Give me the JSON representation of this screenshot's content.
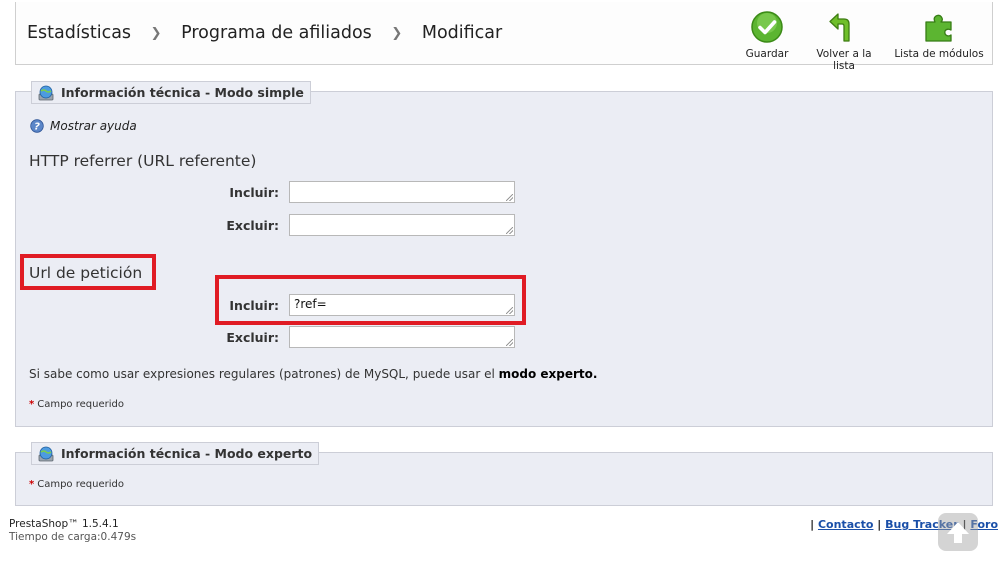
{
  "breadcrumb": {
    "items": [
      "Estadísticas",
      "Programa de afiliados",
      "Modificar"
    ],
    "separator": ">"
  },
  "toolbar": {
    "save_label": "Guardar",
    "back_label": "Volver a la lista",
    "modules_label": "Lista de módulos"
  },
  "fieldset_simple": {
    "legend": "Información técnica - Modo simple",
    "help_link": "Mostrar ayuda",
    "http_referrer": {
      "title": "HTTP referrer (URL referente)",
      "include_label": "Incluir:",
      "include_value": "",
      "exclude_label": "Excluir:",
      "exclude_value": ""
    },
    "request_url": {
      "title": "Url de petición",
      "include_label": "Incluir:",
      "include_value": "?ref=",
      "exclude_label": "Excluir:",
      "exclude_value": ""
    },
    "note_text": "Si sabe como usar expresiones regulares (patrones) de MySQL, puede usar el ",
    "note_link": "modo experto.",
    "required_star": "*",
    "required_text": "Campo requerido"
  },
  "fieldset_expert": {
    "legend": "Información técnica - Modo experto",
    "required_star": "*",
    "required_text": "Campo requerido"
  },
  "footer": {
    "version": "PrestaShop™ 1.5.4.1",
    "load_time": "Tiempo de carga:0.479s",
    "sep": "|",
    "links": [
      "Contacto",
      "Bug Tracker",
      "Foro"
    ]
  },
  "colors": {
    "highlight": "#e01b24",
    "fieldset_bg": "#ebedf4",
    "link": "#1a4fa8"
  },
  "icons": [
    "check-circle-icon",
    "back-arrow-icon",
    "puzzle-icon",
    "info-globe-icon",
    "help-icon",
    "scroll-top-icon"
  ]
}
